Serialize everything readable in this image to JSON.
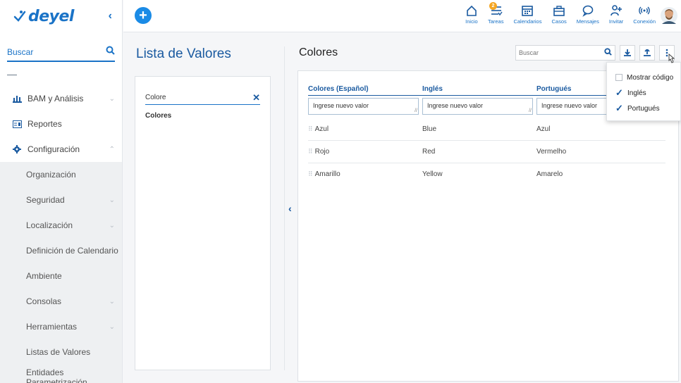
{
  "app": {
    "logo_text": "deyel",
    "collapse_label": "‹"
  },
  "sidebar": {
    "search_placeholder": "Buscar",
    "items": [
      {
        "label": "BAM y Análisis"
      },
      {
        "label": "Reportes"
      },
      {
        "label": "Configuración"
      }
    ],
    "subitems": [
      {
        "label": "Organización"
      },
      {
        "label": "Seguridad"
      },
      {
        "label": "Localización"
      },
      {
        "label": "Definición de Calendario"
      },
      {
        "label": "Ambiente"
      },
      {
        "label": "Consolas"
      },
      {
        "label": "Herramientas"
      },
      {
        "label": "Listas de Valores"
      },
      {
        "label": "Entidades Parametrización"
      }
    ]
  },
  "topbar": {
    "new_button": "+",
    "nav": [
      {
        "label": "Inicio",
        "icon": "home-icon"
      },
      {
        "label": "Tareas",
        "icon": "tasks-icon",
        "badge": "2"
      },
      {
        "label": "Calendarios",
        "icon": "calendar-icon"
      },
      {
        "label": "Casos",
        "icon": "briefcase-icon"
      },
      {
        "label": "Mensajes",
        "icon": "chat-icon"
      },
      {
        "label": "Invitar",
        "icon": "invite-icon"
      },
      {
        "label": "Conexión",
        "icon": "connection-icon"
      }
    ]
  },
  "left_panel": {
    "title": "Lista de Valores",
    "search_value": "Colore",
    "clear_label": "✕",
    "items": [
      {
        "label": "Colores"
      }
    ]
  },
  "detail": {
    "title": "Colores",
    "search_placeholder": "Buscar",
    "columns": [
      "Colores (Español)",
      "Inglés",
      "Portugués"
    ],
    "new_value_placeholder": "Ingrese nuevo valor",
    "rows": [
      [
        "Azul",
        "Blue",
        "Azul"
      ],
      [
        "Rojo",
        "Red",
        "Vermelho"
      ],
      [
        "Amarillo",
        "Yellow",
        "Amarelo"
      ]
    ]
  },
  "dropdown": {
    "items": [
      {
        "label": "Mostrar código",
        "checked": false
      },
      {
        "label": "Inglés",
        "checked": true
      },
      {
        "label": "Portugués",
        "checked": true
      }
    ]
  },
  "colors": {
    "accent": "#1a73c7",
    "primary_dark": "#1a5aa0",
    "badge": "#f5a623"
  }
}
